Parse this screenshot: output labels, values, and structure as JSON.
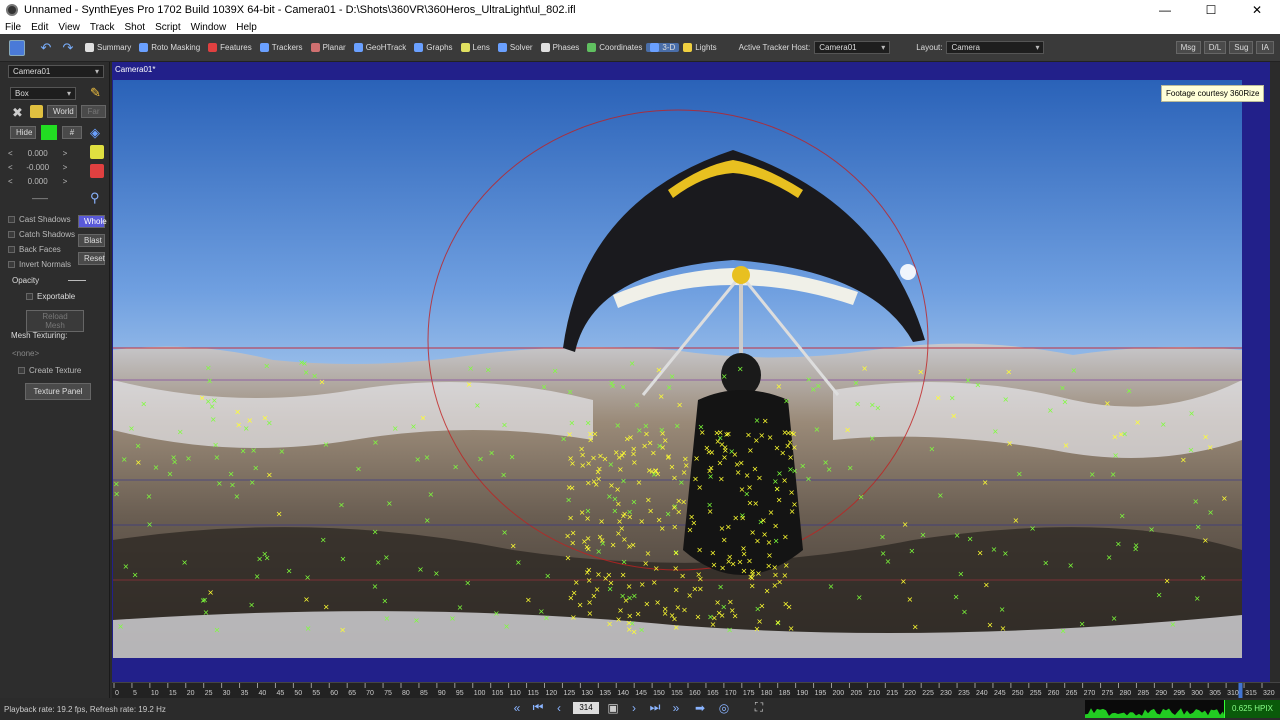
{
  "window": {
    "title": "Unnamed - SynthEyes Pro 1702 Build 1039X 64-bit - Camera01 - D:\\Shots\\360VR\\360Heros_UltraLight\\ul_802.ifl",
    "minimize": "—",
    "maximize": "☐",
    "close": "✕"
  },
  "menu": [
    "File",
    "Edit",
    "View",
    "Track",
    "Shot",
    "Script",
    "Window",
    "Help"
  ],
  "toolbar": {
    "items": [
      {
        "label": "Summary",
        "color": "#e0e0e0"
      },
      {
        "label": "Roto Masking",
        "color": "#6aa0ff"
      },
      {
        "label": "Features",
        "color": "#e04040"
      },
      {
        "label": "Trackers",
        "color": "#6aa0ff"
      },
      {
        "label": "Planar",
        "color": "#d07070"
      },
      {
        "label": "GeoHTrack",
        "color": "#6aa0ff"
      },
      {
        "label": "Graphs",
        "color": "#6aa0ff"
      },
      {
        "label": "Lens",
        "color": "#e0e060"
      },
      {
        "label": "Solver",
        "color": "#6aa0ff"
      },
      {
        "label": "Phases",
        "color": "#e0e0e0"
      },
      {
        "label": "Coordinates",
        "color": "#60c060"
      },
      {
        "label": "3-D",
        "color": "#6aa0ff"
      },
      {
        "label": "Lights",
        "color": "#f0d040"
      }
    ],
    "tracker_host_label": "Active Tracker Host:",
    "tracker_host_value": "Camera01",
    "layout_label": "Layout:",
    "layout_value": "Camera",
    "right_buttons": [
      "Msg",
      "D/L",
      "Sug",
      "IA"
    ]
  },
  "left_panel": {
    "camera_select": "Camera01",
    "object_type": "Box",
    "world_label": "World",
    "far_label": "Far",
    "hide_label": "Hide",
    "hash_label": "#",
    "xyz": [
      "0.000",
      "-0.000",
      "0.000"
    ],
    "dash": "——",
    "cast_shadows": "Cast Shadows",
    "catch_shadows": "Catch Shadows",
    "back_faces": "Back Faces",
    "invert_normals": "Invert Normals",
    "whole_label": "Whole",
    "blast_label": "Blast",
    "reset_label": "Reset",
    "opacity_label": "Opacity",
    "exportable_label": "Exportable",
    "reload_mesh": "Reload Mesh",
    "mesh_texturing": "Mesh Texturing:",
    "none_label": "<none>",
    "create_texture": "Create Texture",
    "texture_panel": "Texture Panel",
    "green_swatch": "#22dd22"
  },
  "viewport": {
    "label": "Camera01*",
    "credit": "Footage courtesy 360Rize",
    "sky_top": "#2a62b8",
    "sky_bottom": "#9cc0ea",
    "tracker_green": "#7dff3a",
    "tracker_yellow": "#ffff30"
  },
  "timeline": {
    "ticks": [
      "0",
      "5",
      "10",
      "15",
      "20",
      "25",
      "30",
      "35",
      "40",
      "45",
      "50",
      "55",
      "60",
      "65",
      "70",
      "75",
      "80",
      "85",
      "90",
      "95",
      "100",
      "105",
      "110",
      "115",
      "120",
      "125",
      "130",
      "135",
      "140",
      "145",
      "150",
      "155",
      "160",
      "165",
      "170",
      "175",
      "180",
      "185",
      "190",
      "195",
      "200",
      "205",
      "210",
      "215",
      "220",
      "225",
      "230",
      "235",
      "240",
      "245",
      "250",
      "255",
      "260",
      "265",
      "270",
      "275",
      "280",
      "285",
      "290",
      "295",
      "300",
      "305",
      "310",
      "315",
      "320"
    ],
    "current": 314
  },
  "status": {
    "text": "Playback rate: 19.2 fps, Refresh rate: 19.2 Hz",
    "frame": "314",
    "hpix": "0.625 HPIX"
  }
}
